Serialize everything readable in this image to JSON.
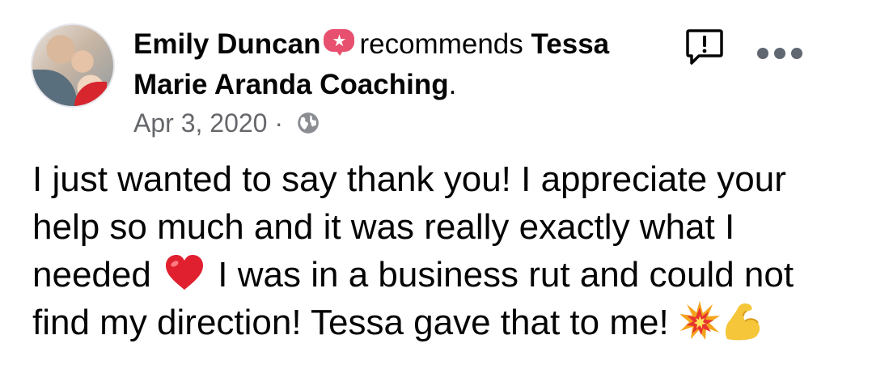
{
  "post": {
    "author": "Emily Duncan",
    "verb": "recommends",
    "page_name": "Tessa Marie Aranda Coaching",
    "punctuation": ".",
    "date": "Apr 3, 2020",
    "separator": "·",
    "audience_icon": "globe-icon",
    "body_part1": "I just wanted to say thank you! I appreciate your help so much and it was really exactly what I needed",
    "body_part2": "I was in a business rut and could not find my direction! Tessa gave that to me!"
  },
  "icons": {
    "recommend": "recommend-star-icon",
    "report": "report-icon",
    "more": "more-options-icon",
    "emoji": [
      "heart-emoji",
      "collision-emoji",
      "flexed-biceps-emoji"
    ]
  },
  "colors": {
    "text": "#050505",
    "secondary_text": "#65676b",
    "recommend_badge": "#e8506f",
    "heart": "#e0202f"
  }
}
